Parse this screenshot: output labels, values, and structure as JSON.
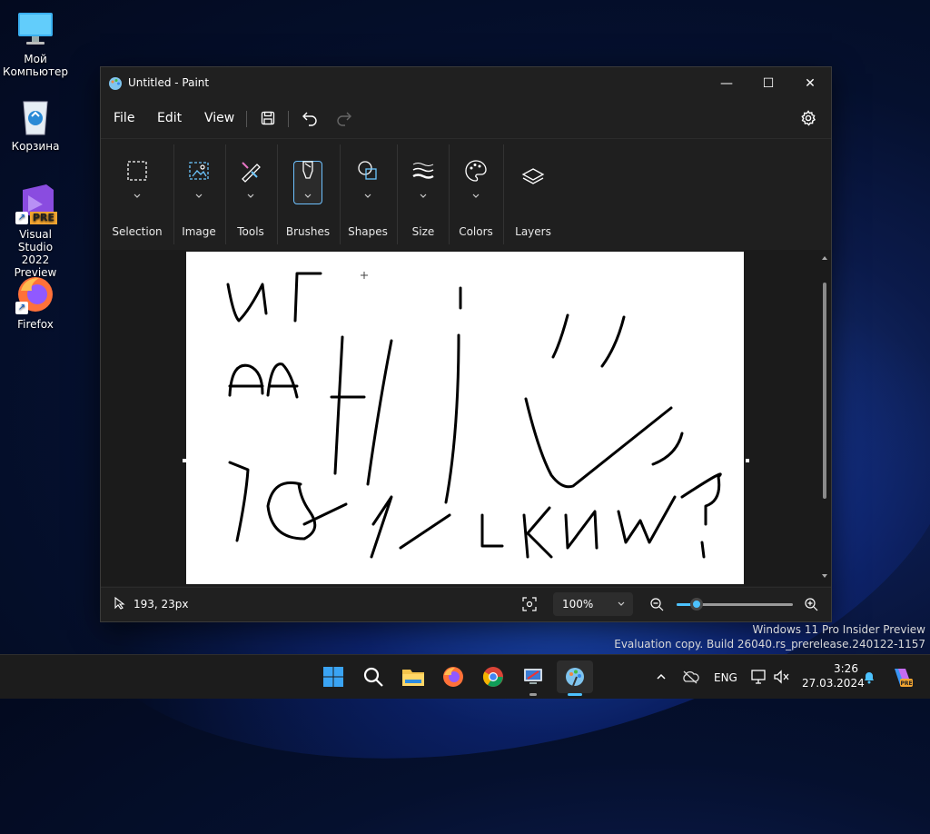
{
  "desktop": {
    "icons": [
      {
        "label_line1": "Мой",
        "label_line2": "Компьютер"
      },
      {
        "label_line1": "Корзина",
        "label_line2": ""
      },
      {
        "label_line1": "Visual Studio",
        "label_line2": "2022 Preview",
        "badge": "PRE"
      },
      {
        "label_line1": "Firefox",
        "label_line2": ""
      }
    ]
  },
  "window": {
    "title": "Untitled - Paint",
    "controls": {
      "minimize": "—",
      "maximize": "☐",
      "close": "✕"
    }
  },
  "menu": {
    "items": [
      "File",
      "Edit",
      "View"
    ],
    "toolbar_icons": [
      "save-icon",
      "undo-icon",
      "redo-icon"
    ],
    "settings_icon": "gear-icon"
  },
  "ribbon": {
    "groups": [
      {
        "label": "Selection",
        "icon": "selection-icon"
      },
      {
        "label": "Image",
        "icon": "image-icon"
      },
      {
        "label": "Tools",
        "icon": "tools-icon"
      },
      {
        "label": "Brushes",
        "icon": "brush-icon",
        "active": true
      },
      {
        "label": "Shapes",
        "icon": "shapes-icon"
      },
      {
        "label": "Size",
        "icon": "size-icon"
      },
      {
        "label": "Colors",
        "icon": "palette-icon"
      },
      {
        "label": "Layers",
        "icon": "layers-icon"
      }
    ]
  },
  "status": {
    "cursor_position": "193, 23px",
    "zoom_level": "100%",
    "zoom_slider_fraction": 0.17
  },
  "watermark": {
    "line1": "Windows 11 Pro Insider Preview",
    "line2": "Evaluation copy. Build 26040.rs_prerelease.240122-1157"
  },
  "taskbar": {
    "tray": {
      "language": "ENG",
      "time": "3:26",
      "date": "27.03.2024"
    }
  },
  "colors": {
    "accent": "#4cc2ff",
    "window_bg": "#202020",
    "taskbar_bg": "#1c1c1c"
  }
}
